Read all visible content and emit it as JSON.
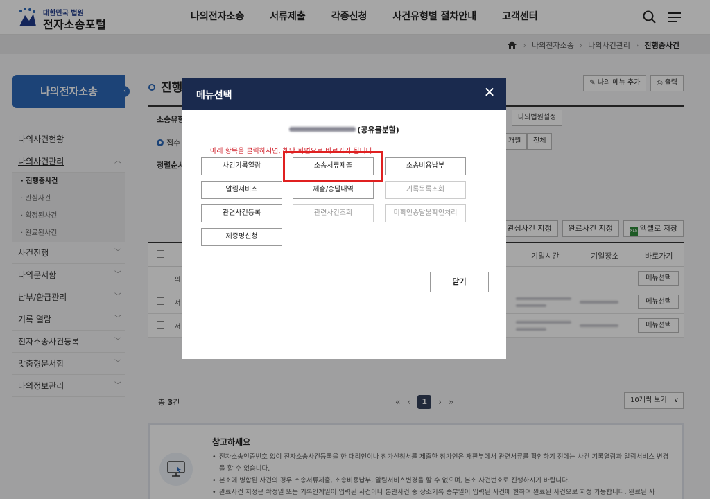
{
  "header": {
    "logo_sub": "대한민국 법원",
    "logo_main": "전자소송포털",
    "nav": [
      "나의전자소송",
      "서류제출",
      "각종신청",
      "사건유형별 절차안내",
      "고객센터"
    ],
    "icons": [
      "search-icon",
      "menu-icon"
    ]
  },
  "breadcrumb": {
    "items": [
      "나의전자소송",
      "나의사건관리",
      "진행중사건"
    ]
  },
  "sidebar": {
    "title": "나의전자소송",
    "items": [
      {
        "label": "나의사건현황"
      },
      {
        "label": "나의사건관리",
        "open": true,
        "sub": [
          "진행중사건",
          "관심사건",
          "확정된사건",
          "완료된사건"
        ]
      },
      {
        "label": "사건진행"
      },
      {
        "label": "나의문서함"
      },
      {
        "label": "납부/환급관리"
      },
      {
        "label": "기록 열람"
      },
      {
        "label": "전자소송사건등록"
      },
      {
        "label": "맞춤형문서함"
      },
      {
        "label": "나의정보관리"
      }
    ]
  },
  "main": {
    "title": "진행",
    "top_buttons": [
      "나의 메뉴 추가",
      "출력"
    ],
    "filter": {
      "label_type": "소송유형",
      "court_btn": "나의법원설정",
      "radio_label": "접수",
      "period_btns": [
        "개월",
        "전체"
      ],
      "sort_label": "정렬순서"
    },
    "action_buttons": [
      "관심사건 지정",
      "완료사건 지정",
      "엑셀로 저장"
    ],
    "table": {
      "headers": [
        "기일시간",
        "기일장소",
        "바로가기"
      ],
      "rows": [
        {
          "prefix": "의",
          "button": "메뉴선택"
        },
        {
          "prefix": "서",
          "button": "메뉴선택"
        },
        {
          "prefix": "서",
          "button": "메뉴선택"
        }
      ]
    },
    "count_prefix": "총",
    "count": "3",
    "count_suffix": "건",
    "pager": {
      "first": "«",
      "prev": "‹",
      "current": "1",
      "next": "›",
      "last": "»"
    },
    "per_page": "10개씩 보기"
  },
  "notice": {
    "title": "참고하세요",
    "items": [
      "전자소송인증번호 없이 전자소송사건등록을 한 대리인이나 참가신청서를 제출한 참가인은 재판부에서 관련서류를 확인하기 전에는 사건 기록열람과 알림서비스 변경을 할 수 없습니다.",
      "본소에 병합된 사건의 경우 소송서류제출, 소송비용납부, 알림서비스변경을 할 수 없으며, 본소 사건번호로 진행하시기 바랍니다.",
      "완료사건 지정은 확정일 또는 기록인계일이 입력된 사건이나 본안사건 중 상소기록 송부일이 입력된 사건에 한하여 완료된 사건으로 지정 가능합니다. 완료된 사"
    ]
  },
  "modal": {
    "title": "메뉴선택",
    "case_suffix": "(공유물분할)",
    "notice": "아래 항목을 클릭하시면, 해당 화면으로 바로가기 됩니다.",
    "buttons": [
      {
        "label": "사건기록열람",
        "enabled": true
      },
      {
        "label": "소송서류제출",
        "enabled": true
      },
      {
        "label": "소송비용납부",
        "enabled": true
      },
      {
        "label": "알림서비스",
        "enabled": true
      },
      {
        "label": "제출/송달내역",
        "enabled": true
      },
      {
        "label": "기록목록조회",
        "enabled": false
      },
      {
        "label": "관련사건등록",
        "enabled": true
      },
      {
        "label": "관련사건조회",
        "enabled": false
      },
      {
        "label": "미확인송달물확인처리",
        "enabled": false
      },
      {
        "label": "제증명신청",
        "enabled": true
      }
    ],
    "close_label": "닫기"
  },
  "colors": {
    "brand_blue": "#2b67b7",
    "modal_header": "#1a2a4e",
    "highlight_red": "#e02020",
    "notice_red": "#d0202a"
  }
}
